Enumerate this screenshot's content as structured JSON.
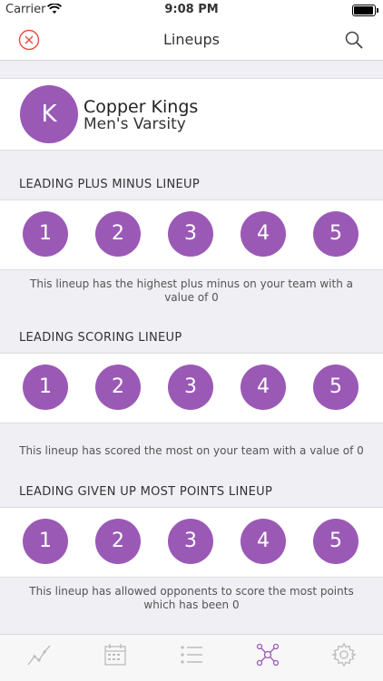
{
  "status_bar": {
    "carrier": "Carrier",
    "time": "9:08 PM"
  },
  "nav": {
    "title": "Lineups"
  },
  "team": {
    "initial": "K",
    "name": "Copper Kings",
    "division": "Men's Varsity"
  },
  "colors": {
    "accent": "#9b59b6",
    "close": "#e74c3c",
    "active_tab": "#9b59b6"
  },
  "sections": [
    {
      "title": "LEADING PLUS MINUS LINEUP",
      "players": [
        "1",
        "2",
        "3",
        "4",
        "5"
      ],
      "description": "This lineup has the highest plus minus on your team with a value of 0"
    },
    {
      "title": "LEADING SCORING LINEUP",
      "players": [
        "1",
        "2",
        "3",
        "4",
        "5"
      ],
      "description": "This lineup has scored the most on your team with a value of 0"
    },
    {
      "title": "LEADING GIVEN UP MOST POINTS LINEUP",
      "players": [
        "1",
        "2",
        "3",
        "4",
        "5"
      ],
      "description": "This lineup has allowed opponents to score the most points which has been 0"
    }
  ],
  "tab_bar": {
    "items": [
      {
        "icon": "chart-icon",
        "active": false
      },
      {
        "icon": "calendar-icon",
        "active": false
      },
      {
        "icon": "list-icon",
        "active": false
      },
      {
        "icon": "network-icon",
        "active": true
      },
      {
        "icon": "gear-icon",
        "active": false
      }
    ]
  }
}
